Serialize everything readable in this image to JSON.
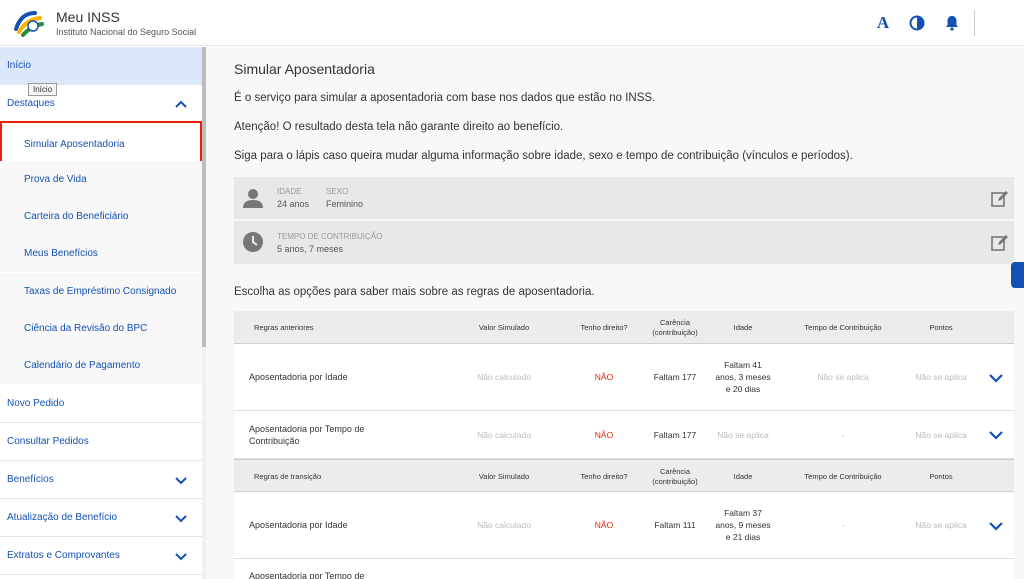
{
  "header": {
    "title": "Meu INSS",
    "subtitle": "Instituto Nacional do Seguro Social",
    "font_button": "A"
  },
  "sidebar": {
    "tooltip": "Início",
    "items": [
      {
        "label": "Início"
      },
      {
        "label": "Destaques"
      },
      {
        "label": "Simular Aposentadoria"
      },
      {
        "label": "Prova de Vida"
      },
      {
        "label": "Carteira do Beneficiário"
      },
      {
        "label": "Meus Benefícios"
      },
      {
        "label": "Taxas de Empréstimo Consignado"
      },
      {
        "label": "Ciência da Revisão do BPC"
      },
      {
        "label": "Calendário de Pagamento"
      },
      {
        "label": "Novo Pedido"
      },
      {
        "label": "Consultar Pedidos"
      },
      {
        "label": "Benefícios"
      },
      {
        "label": "Atualização de Benefício"
      },
      {
        "label": "Extratos e Comprovantes"
      }
    ]
  },
  "main": {
    "title": "Simular Aposentadoria",
    "paragraphs": [
      "É o serviço para simular a aposentadoria com base nos dados que estão no INSS.",
      "Atenção! O resultado desta tela não garante direito ao benefício.",
      "Siga para o lápis caso queira mudar alguma informação sobre idade, sexo e tempo de contribuição (vínculos e períodos)."
    ],
    "profile": {
      "age_label": "IDADE",
      "age_value": "24 anos",
      "sex_label": "SEXO",
      "sex_value": "Feminino",
      "contrib_label": "TEMPO DE CONTRIBUIÇÃO",
      "contrib_value": "5 anos, 7 meses"
    },
    "options_text": "Escolha as opções para saber mais sobre as regras de aposentadoria.",
    "table1": {
      "headers": [
        "Regras anteriores",
        "Valor Simulado",
        "Tenho direito?",
        "Carência (contribuição)",
        "Idade",
        "Tempo de Contribuição",
        "Pontos"
      ],
      "rows": [
        {
          "name": "Aposentadoria por Idade",
          "valor": "Não calculado",
          "direito": "NÃO",
          "carencia": "Faltam 177",
          "idade": "Faltam 41 anos, 3 meses e 20 dias",
          "tempo": "Não se aplica",
          "pontos": "Não se aplica"
        },
        {
          "name": "Aposentadoria por Tempo de Contribuição",
          "valor": "Não calculado",
          "direito": "NÃO",
          "carencia": "Faltam 177",
          "idade": "Não se aplica",
          "tempo": "-",
          "pontos": "Não se aplica"
        }
      ]
    },
    "table2": {
      "headers": [
        "Regras de transição",
        "Valor Simulado",
        "Tenho direito?",
        "Carência (contribuição)",
        "Idade",
        "Tempo de Contribuição",
        "Pontos"
      ],
      "rows": [
        {
          "name": "Aposentadoria por Idade",
          "valor": "Não calculado",
          "direito": "NÃO",
          "carencia": "Faltam 111",
          "idade": "Faltam 37 anos, 9 meses e 21 dias",
          "tempo": "-",
          "pontos": "Não se aplica"
        },
        {
          "name": "Aposentadoria por Tempo de"
        }
      ]
    }
  },
  "colors": {
    "primary": "#1351b4",
    "danger": "#e52207",
    "active_bg": "#dbe8fb"
  }
}
